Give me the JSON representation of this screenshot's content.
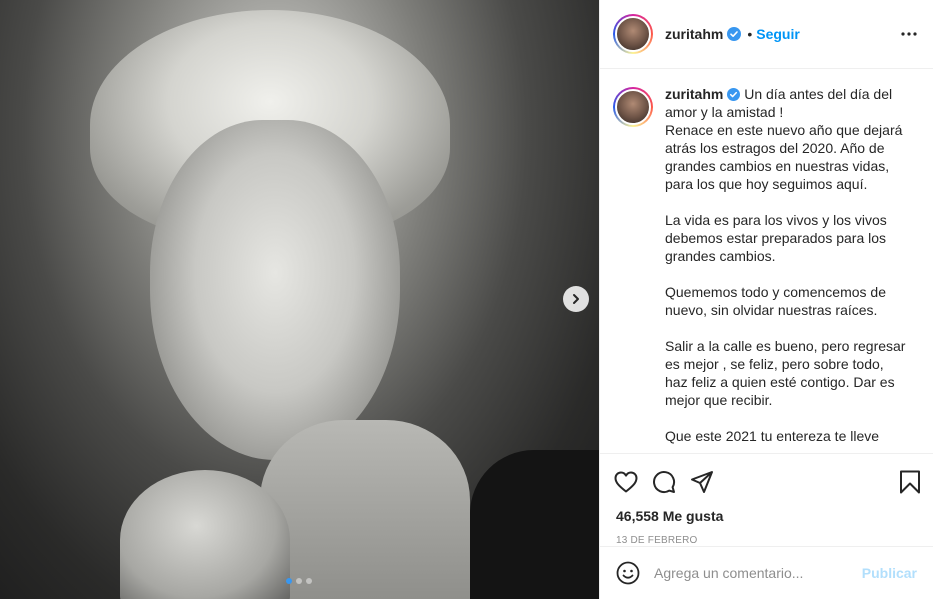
{
  "post": {
    "username": "zuritahm",
    "separator": "•",
    "follow_label": "Seguir",
    "caption_text": " Un día antes del día del amor y la amistad !\nRenace en este nuevo año que dejará atrás los estragos del 2020. Año de grandes cambios en nuestras vidas, para los que hoy seguimos aquí.\n\nLa vida es para los vivos y los vivos debemos estar preparados para los grandes cambios.\n\nQuememos todo y comencemos de nuevo, sin olvidar nuestras raíces.\n\nSalir a la calle es bueno, pero regresar es mejor , se feliz, pero sobre todo, haz feliz a quien esté contigo. Dar es mejor que recibir.\n\nQue este 2021 tu entereza te lleve",
    "likes": "46,558 Me gusta",
    "date": "13 DE FEBRERO",
    "carousel": {
      "slides": 3,
      "active_index": 0
    }
  },
  "comment": {
    "placeholder": "Agrega un comentario...",
    "publish_label": "Publicar"
  },
  "colors": {
    "accent": "#0095f6",
    "publish_disabled": "#b2dffc",
    "verified": "#3897f0",
    "text": "#262626",
    "muted": "#8e8e8e"
  },
  "icons": {
    "more": "more-horizontal-icon",
    "like": "heart-icon",
    "comment": "comment-bubble-icon",
    "share": "paper-plane-icon",
    "save": "bookmark-icon",
    "emoji": "smiley-icon",
    "next": "chevron-right-icon",
    "verified": "verified-badge-icon"
  }
}
